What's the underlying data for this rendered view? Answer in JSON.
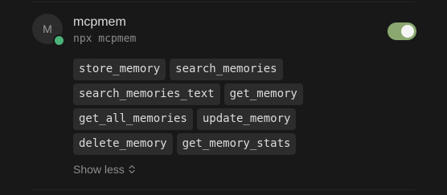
{
  "server": {
    "avatar_letter": "M",
    "name": "mcpmem",
    "command": "npx mcpmem",
    "status_color": "#4bb37a",
    "enabled": true,
    "toggle_color": "#8aa870"
  },
  "tools": [
    [
      "store_memory",
      "search_memories"
    ],
    [
      "search_memories_text",
      "get_memory"
    ],
    [
      "get_all_memories",
      "update_memory"
    ],
    [
      "delete_memory",
      "get_memory_stats"
    ]
  ],
  "show_less_label": "Show less",
  "show_less_icon": "chevron-up-down-icon"
}
